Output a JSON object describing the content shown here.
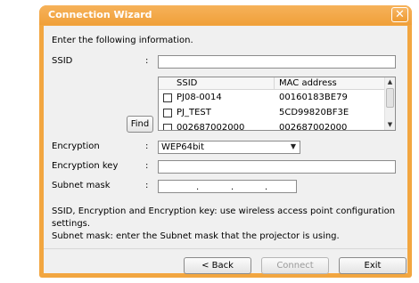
{
  "dialog": {
    "title": "Connection Wizard",
    "close_symbol": "✕",
    "instruction": "Enter the following information."
  },
  "ssid": {
    "label": "SSID",
    "colon": ":",
    "value": "",
    "find_label": "Find",
    "list_headers": [
      "SSID",
      "MAC address"
    ],
    "list_rows": [
      {
        "ssid": "PJ08-0014",
        "mac": "00160183BE79",
        "checked": false
      },
      {
        "ssid": "PJ_TEST",
        "mac": "5CD99820BF3E",
        "checked": false
      },
      {
        "ssid": "002687002000",
        "mac": "002687002000",
        "checked": false
      }
    ]
  },
  "encryption": {
    "label": "Encryption",
    "colon": ":",
    "selected": "WEP64bit"
  },
  "encryption_key": {
    "label": "Encryption key",
    "colon": ":",
    "value": ""
  },
  "subnet_mask": {
    "label": "Subnet mask",
    "colon": ":",
    "dot": "."
  },
  "help": {
    "line1": "SSID, Encryption and Encryption key: use wireless access point configuration",
    "line2": "settings.",
    "line3": "Subnet mask: enter the Subnet mask that the projector is using."
  },
  "buttons": {
    "back": "< Back",
    "connect": "Connect",
    "exit": "Exit"
  },
  "colors": {
    "titlebar": "#f0a03a",
    "client": "#f0f0f0"
  }
}
